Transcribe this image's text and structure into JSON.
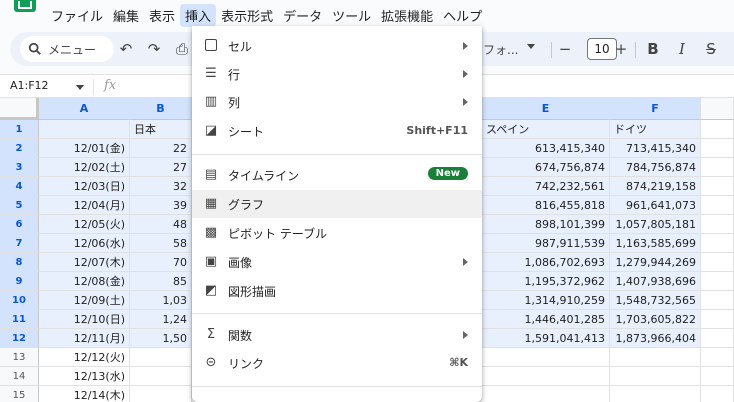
{
  "menubar": [
    "ファイル",
    "編集",
    "表示",
    "挿入",
    "表示形式",
    "データ",
    "ツール",
    "拡張機能",
    "ヘルプ"
  ],
  "toolbar": {
    "search_placeholder": "メニュー",
    "font": "フォ...",
    "font_size": "10",
    "minus": "−",
    "plus": "+",
    "bold": "B",
    "italic": "I",
    "strike": "S"
  },
  "formula": {
    "name_box": "A1:F12",
    "fx": "fx"
  },
  "columns": [
    "A",
    "B",
    "E",
    "F"
  ],
  "rows": [
    "1",
    "2",
    "3",
    "4",
    "5",
    "6",
    "7",
    "8",
    "9",
    "10",
    "11",
    "12",
    "13",
    "14",
    "15"
  ],
  "cells": {
    "a": [
      "",
      "12/01(金)",
      "12/02(土)",
      "12/03(日)",
      "12/04(月)",
      "12/05(火)",
      "12/06(水)",
      "12/07(木)",
      "12/08(金)",
      "12/09(土)",
      "12/10(日)",
      "12/11(月)",
      "12/12(火)",
      "12/13(水)",
      "12/14(木)"
    ],
    "b": [
      "日本",
      "22",
      "27",
      "32",
      "39",
      "48",
      "58",
      "70",
      "85",
      "1,03",
      "1,24",
      "1,50",
      "",
      "",
      ""
    ],
    "e": [
      "スペイン",
      "613,415,340",
      "674,756,874",
      "742,232,561",
      "816,455,818",
      "898,101,399",
      "987,911,539",
      "1,086,702,693",
      "1,195,372,962",
      "1,314,910,259",
      "1,446,401,285",
      "1,591,041,413",
      "",
      "",
      ""
    ],
    "f": [
      "ドイツ",
      "713,415,340",
      "784,756,874",
      "874,219,158",
      "961,641,073",
      "1,057,805,181",
      "1,163,585,699",
      "1,279,944,269",
      "1,407,938,696",
      "1,548,732,565",
      "1,703,605,822",
      "1,873,966,404",
      "",
      "",
      ""
    ]
  },
  "menu": {
    "items": [
      {
        "label": "セル",
        "icon": "cell-icon"
      },
      {
        "label": "行",
        "icon": "row-icon"
      },
      {
        "label": "列",
        "icon": "column-icon"
      },
      {
        "label": "シート",
        "icon": "sheet-icon",
        "shortcut": "Shift+F11"
      },
      {
        "label": "タイムライン",
        "icon": "timeline-icon",
        "badge": "New"
      },
      {
        "label": "グラフ",
        "icon": "chart-icon"
      },
      {
        "label": "ピボット テーブル",
        "icon": "pivot-table-icon"
      },
      {
        "label": "画像",
        "icon": "image-icon"
      },
      {
        "label": "図形描画",
        "icon": "drawing-icon"
      },
      {
        "label": "関数",
        "icon": "sigma-icon"
      },
      {
        "label": "リンク",
        "icon": "link-icon",
        "shortcut": "⌘K"
      }
    ]
  }
}
